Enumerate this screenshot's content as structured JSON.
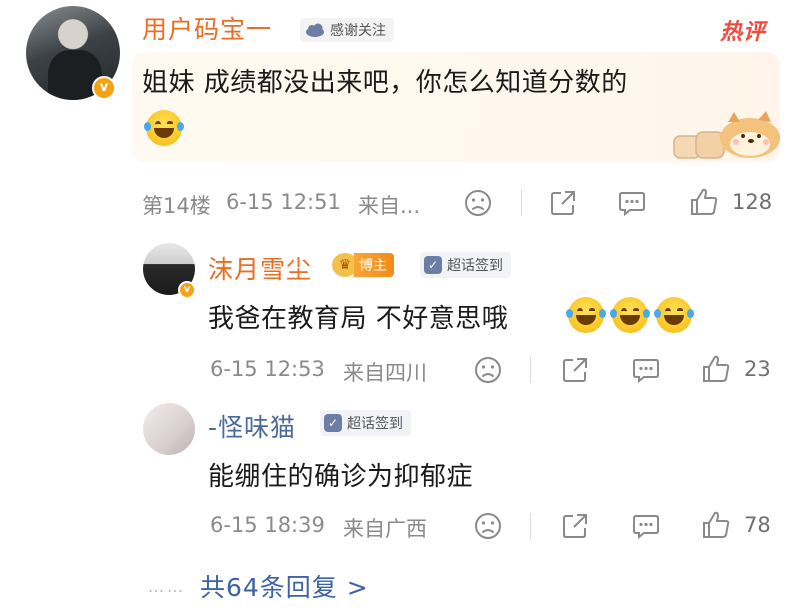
{
  "main_comment": {
    "username": "用户码宝一",
    "thanks_badge": "感谢关注",
    "hot_tag": "热评",
    "content": "姐妹 成绩都没出来吧，你怎么知道分数的",
    "floor": "第14楼",
    "time": "6-15 12:51",
    "source": "来自...",
    "likes": "128"
  },
  "replies": [
    {
      "username": "沫月雪尘",
      "badge_blogger": "博主",
      "badge_topic": "超话签到",
      "content": "我爸在教育局 不好意思哦",
      "time": "6-15 12:53",
      "source": "来自四川",
      "likes": "23"
    },
    {
      "username": "-怪味猫",
      "badge_topic": "超话签到",
      "content": "能绷住的确诊为抑郁症",
      "time": "6-15 18:39",
      "source": "来自广西",
      "likes": "78"
    }
  ],
  "more_replies": "共64条回复 >",
  "colors": {
    "username_accent": "#ea6d24",
    "link_blue": "#3d63a6",
    "hot_red": "#f0493e"
  },
  "icons": [
    "dislike-face-icon",
    "share-icon",
    "comment-icon",
    "like-thumb-icon",
    "laugh-cry-emoji"
  ]
}
